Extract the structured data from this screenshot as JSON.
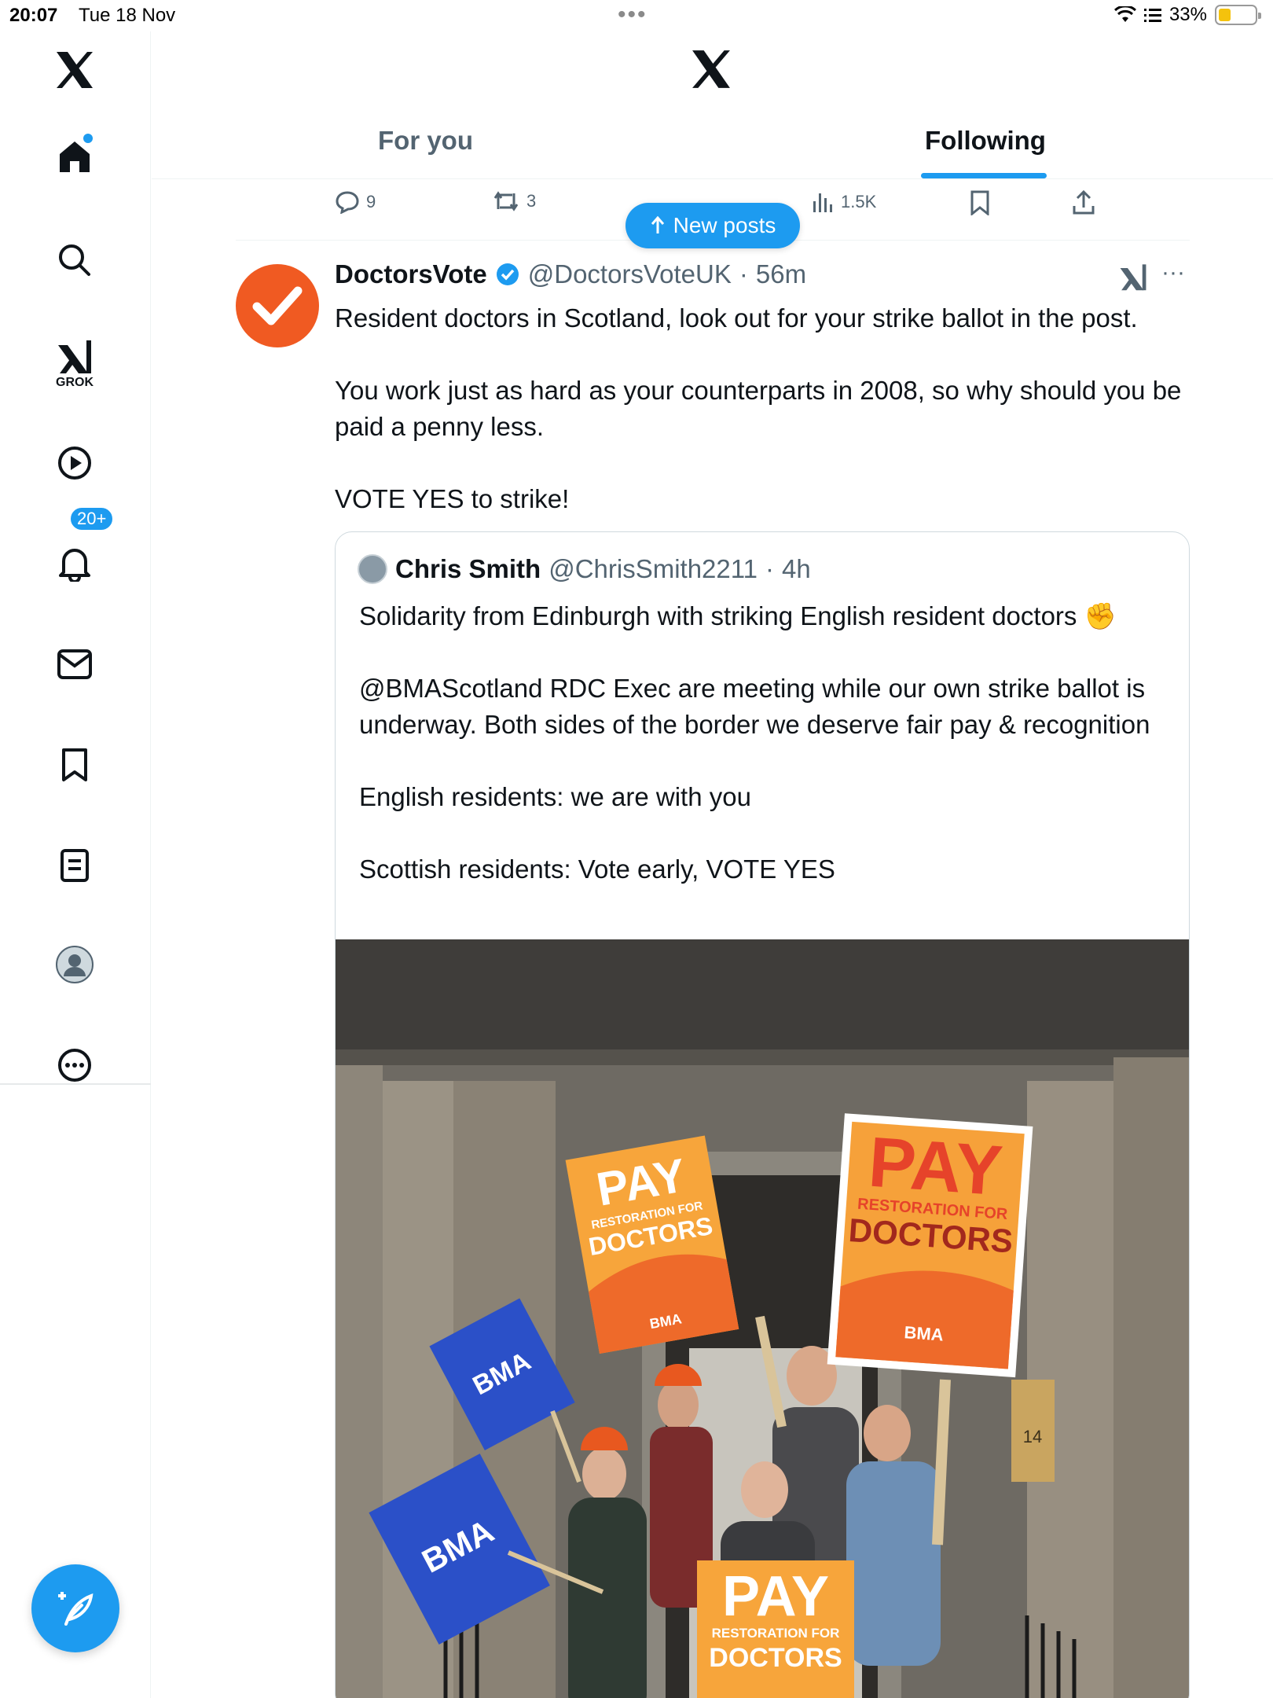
{
  "status_bar": {
    "time": "20:07",
    "date": "Tue 18 Nov",
    "battery": "33%",
    "battery_level": 0.33
  },
  "sidebar": {
    "grok_label": "GROK",
    "notifications_badge": "20+"
  },
  "header": {
    "tabs": [
      {
        "label": "For you",
        "active": false
      },
      {
        "label": "Following",
        "active": true
      }
    ]
  },
  "prev_post_actions": {
    "replies": "9",
    "reposts": "3",
    "views": "1.5K"
  },
  "new_posts": {
    "label": "New posts"
  },
  "post": {
    "name": "DoctorsVote",
    "handle": "@DoctorsVoteUK",
    "time": "56m",
    "paragraphs": [
      "Resident doctors in Scotland, look out for your strike ballot in the post.",
      "You work just as hard as your counterparts in 2008, so why should you be paid a penny less.",
      "VOTE YES to strike!"
    ],
    "quote": {
      "name": "Chris Smith",
      "handle": "@ChrisSmith2211",
      "time": "4h",
      "paragraphs": [
        "Solidarity from Edinburgh with striking English resident doctors ✊",
        "@BMAScotland RDC Exec are meeting while our own strike ballot is underway. Both sides of the border we deserve fair pay & recognition",
        "English residents: we are with you",
        "Scottish residents: Vote early, VOTE YES"
      ],
      "photo": {
        "placards": [
          {
            "big": "PAY",
            "small": "RESTORATION FOR",
            "mid": "DOCTORS",
            "logo": "BMA"
          }
        ],
        "flag_text": "BMA",
        "door_number": "14"
      }
    }
  },
  "colors": {
    "accent": "#1d9bf0",
    "brand_orange": "#f05a22",
    "text": "#0f1419",
    "muted": "#536471"
  }
}
